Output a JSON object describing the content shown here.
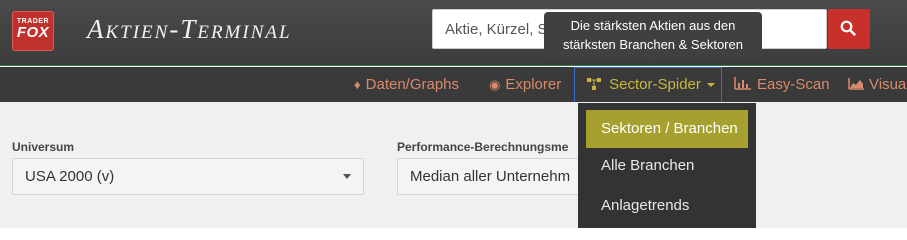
{
  "header": {
    "logo_line1": "TRADER",
    "logo_line2": "FOX",
    "title": "Aktien-Terminal",
    "search_placeholder": "Aktie, Kürzel, ...",
    "search_value": "Aktie, Kürzel, S"
  },
  "tooltip": {
    "line1": "Die stärksten Aktien aus den",
    "line2": "stärksten Branchen & Sektoren"
  },
  "nav": {
    "items": [
      {
        "label": "Daten/Graphs",
        "icon": "diamond-icon"
      },
      {
        "label": "Explorer",
        "icon": "globe-icon"
      },
      {
        "label": "Sector-Spider",
        "icon": "sitemap-icon"
      },
      {
        "label": "Easy-Scan",
        "icon": "chart-icon"
      },
      {
        "label": "Visual",
        "icon": "area-chart-icon"
      }
    ]
  },
  "dropdown": {
    "items": [
      "Sektoren / Branchen",
      "Alle Branchen",
      "Anlagetrends"
    ],
    "selected_index": 0
  },
  "filters": {
    "universe_label": "Universum",
    "universe_value": "USA 2000 (v)",
    "performance_label": "Performance-Berechnungsme",
    "performance_value": "Median aller Unternehm"
  },
  "colors": {
    "accent_red": "#c9302c",
    "nav_link": "#d98a6a",
    "active_yellow": "#c9b63a",
    "selected_bg": "#a6a12e"
  }
}
